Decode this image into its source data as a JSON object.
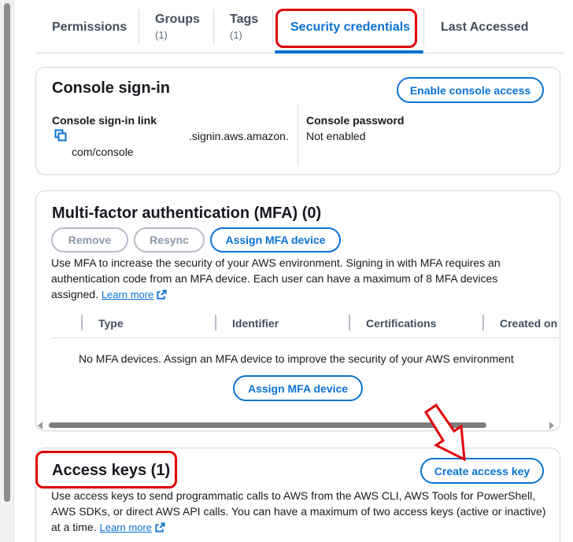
{
  "tabs": [
    {
      "label": "Permissions",
      "count": ""
    },
    {
      "label": "Groups",
      "count": "(1)"
    },
    {
      "label": "Tags",
      "count": "(1)"
    },
    {
      "label": "Security credentials",
      "count": ""
    },
    {
      "label": "Last Accessed",
      "count": ""
    }
  ],
  "active_tab": "Security credentials",
  "console_signin": {
    "title": "Console sign-in",
    "enable_button": "Enable console access",
    "link_label": "Console sign-in link",
    "link_value_line1": ".signin.aws.amazon.",
    "link_value_line2": "com/console",
    "password_label": "Console password",
    "password_value": "Not enabled"
  },
  "mfa": {
    "title": "Multi-factor authentication (MFA) (0)",
    "remove_button": "Remove",
    "resync_button": "Resync",
    "assign_button": "Assign MFA device",
    "description": "Use MFA to increase the security of your AWS environment. Signing in with MFA requires an authentication code from an MFA device. Each user can have a maximum of 8 MFA devices assigned.",
    "learn_more": "Learn more",
    "columns": [
      "Type",
      "Identifier",
      "Certifications",
      "Created on"
    ],
    "empty_message": "No MFA devices. Assign an MFA device to improve the security of your AWS environment",
    "empty_assign_button": "Assign MFA device"
  },
  "access_keys": {
    "title": "Access keys (1)",
    "create_button": "Create access key",
    "description": "Use access keys to send programmatic calls to AWS from the AWS CLI, AWS Tools for PowerShell, AWS SDKs, or direct AWS API calls. You can have a maximum of two access keys (active or inactive) at a time.",
    "learn_more": "Learn more"
  },
  "colors": {
    "accent": "#0972d3",
    "annotation_red": "#e0000b",
    "border": "#d5dbdb",
    "disabled": "#8d99a8"
  },
  "icons": [
    "copy-icon",
    "external-link-icon",
    "red-arrow-annotation"
  ]
}
